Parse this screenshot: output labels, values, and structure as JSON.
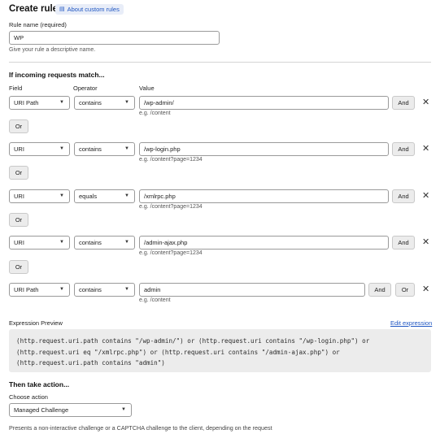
{
  "header": {
    "title": "Create rule",
    "about_link": "About custom rules"
  },
  "rule_name": {
    "label": "Rule name (required)",
    "value": "WP",
    "hint": "Give your rule a descriptive name."
  },
  "match": {
    "heading": "If incoming requests match...",
    "col_field": "Field",
    "col_operator": "Operator",
    "col_value": "Value",
    "rows": [
      {
        "field": "URI Path",
        "operator": "contains",
        "value": "/wp-admin/",
        "hint": "e.g. /content"
      },
      {
        "field": "URI",
        "operator": "contains",
        "value": "/wp-login.php",
        "hint": "e.g. /content?page=1234"
      },
      {
        "field": "URI",
        "operator": "equals",
        "value": "/xmlrpc.php",
        "hint": "e.g. /content?page=1234"
      },
      {
        "field": "URI",
        "operator": "contains",
        "value": "/admin-ajax.php",
        "hint": "e.g. /content?page=1234"
      },
      {
        "field": "URI Path",
        "operator": "contains",
        "value": "admin",
        "hint": "e.g. /content"
      }
    ],
    "and_label": "And",
    "or_label": "Or",
    "remove_icon": "close-icon"
  },
  "expression": {
    "label": "Expression Preview",
    "edit_link": "Edit expression",
    "text": "(http.request.uri.path contains \"/wp-admin/\") or (http.request.uri contains \"/wp-login.php\") or\n(http.request.uri eq \"/xmlrpc.php\") or (http.request.uri contains \"/admin-ajax.php\") or\n(http.request.uri.path contains \"admin\")"
  },
  "action": {
    "heading": "Then take action...",
    "label": "Choose action",
    "value": "Managed Challenge",
    "description": "Presents a non-interactive challenge or a CAPTCHA challenge to the client, depending on the request"
  },
  "colors": {
    "accent": "#1f56c2",
    "badge_bg": "#e8edf8",
    "button_bg": "#ececec",
    "code_bg": "#ececec"
  }
}
